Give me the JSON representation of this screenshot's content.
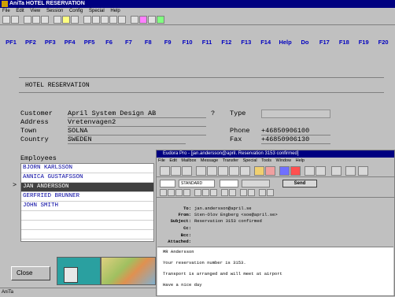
{
  "window": {
    "title": "AniTa HOTEL RESERVATION"
  },
  "menubar": [
    "File",
    "Edit",
    "View",
    "Session",
    "Config",
    "Special",
    "Help"
  ],
  "pf_keys": [
    "PF1",
    "PF2",
    "PF3",
    "PF4",
    "PF5",
    "F6",
    "F7",
    "F8",
    "F9",
    "F10",
    "F11",
    "F12",
    "F13",
    "F14",
    "Help",
    "Do",
    "F17",
    "F18",
    "F19",
    "F20"
  ],
  "form": {
    "header": "HOTEL RESERVATION",
    "customer_label": "Customer",
    "customer_value": "April System Design AB",
    "question_mark": "?",
    "type_label": "Type",
    "address_label": "Address",
    "address_value": "Vretenvagen2",
    "town_label": "Town",
    "town_value": "SOLNA",
    "phone_label": "Phone",
    "phone_value": "+46850906100",
    "country_label": "Country",
    "country_value": "SWEDEN",
    "fax_label": "Fax",
    "fax_value": "+46850906130",
    "employees_label": "Employees",
    "employees": [
      "BJORN KARLSSON",
      "ANNICA GUSTAFSSON",
      "JAN ANDERSSON",
      "GERFRIED BRUNNER",
      "JOHN SMITH"
    ],
    "selected_marker": ">",
    "close_label": "Close"
  },
  "statusbar": {
    "text": "AniTa"
  },
  "eudora": {
    "title": "Eudora Pro - [jan.andersson@april. Reservation 3153 confirmed]",
    "menu": [
      "File",
      "Edit",
      "Mailbox",
      "Message",
      "Transfer",
      "Special",
      "Tools",
      "Window",
      "Help"
    ],
    "style_select": "STANDARD",
    "send_label": "Send",
    "to_label": "To:",
    "to_value": "jan.andersson@april.se",
    "from_label": "From:",
    "from_value": "Sten-Olov Engberg <soe@april.se>",
    "subject_label": "Subject:",
    "subject_value": "Reservation 3153 confirmed",
    "cc_label": "Cc:",
    "bcc_label": "Bcc:",
    "attached_label": "Attached:",
    "body": [
      "MR Andersson",
      "Your reservation number is 3153.",
      "Transport is arranged and will meet at airport",
      "Have a nice day"
    ]
  }
}
